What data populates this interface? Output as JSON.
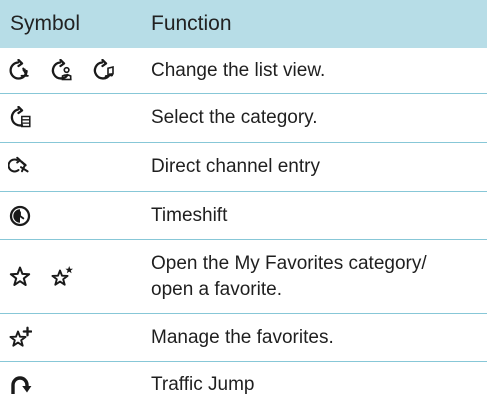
{
  "table": {
    "header": {
      "symbol": "Symbol",
      "function": "Function"
    },
    "rows": [
      {
        "icons": [
          "list-view-station-icon",
          "list-view-person-icon",
          "list-view-music-icon"
        ],
        "function": "Change the list view."
      },
      {
        "icons": [
          "category-icon"
        ],
        "function": "Select the category."
      },
      {
        "icons": [
          "direct-channel-entry-icon"
        ],
        "function": "Direct channel entry"
      },
      {
        "icons": [
          "timeshift-icon"
        ],
        "function": "Timeshift"
      },
      {
        "icons": [
          "star-outline-icon",
          "star-with-star-icon"
        ],
        "function": "Open the My Favorites category/\nopen a favorite."
      },
      {
        "icons": [
          "star-plus-icon"
        ],
        "function": "Manage the favorites."
      },
      {
        "icons": [
          "traffic-jump-icon"
        ],
        "function": "Traffic Jump"
      }
    ]
  },
  "colors": {
    "header_bg": "#b7dde7",
    "row_divider": "#87c7d7",
    "text": "#1f1f1f"
  }
}
